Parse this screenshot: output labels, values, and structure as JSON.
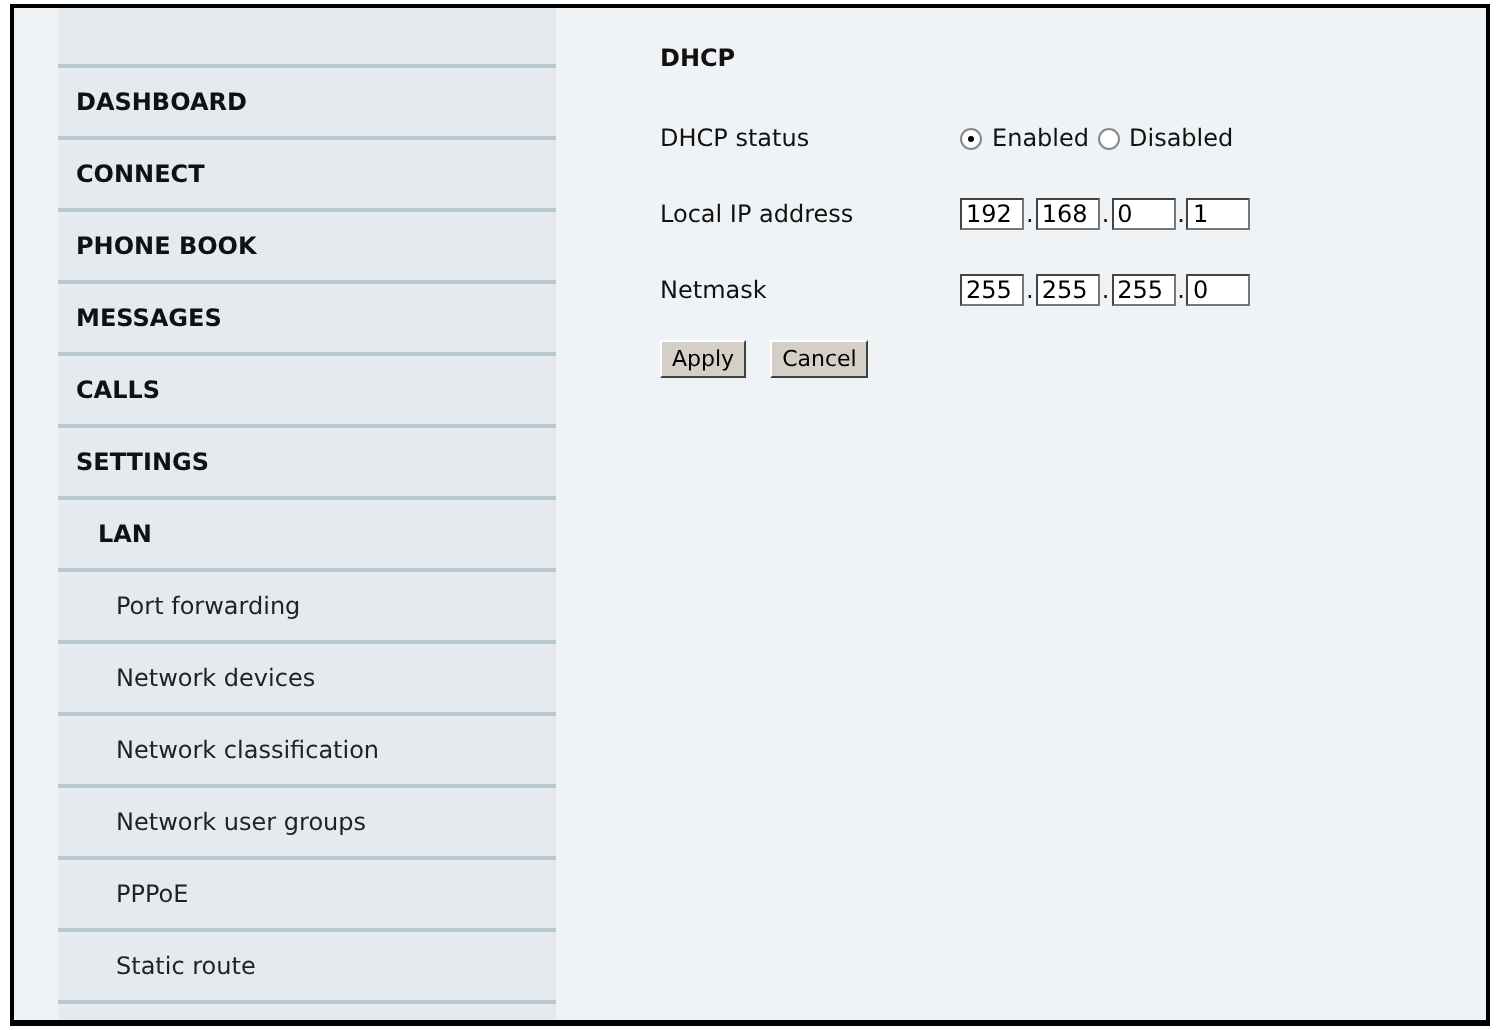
{
  "sidebar": {
    "items": [
      {
        "label": "DASHBOARD"
      },
      {
        "label": "CONNECT"
      },
      {
        "label": "PHONE BOOK"
      },
      {
        "label": "MESSAGES"
      },
      {
        "label": "CALLS"
      },
      {
        "label": "SETTINGS",
        "children": [
          {
            "label": "LAN",
            "children": [
              {
                "label": "Port forwarding"
              },
              {
                "label": "Network devices"
              },
              {
                "label": "Network classification"
              },
              {
                "label": "Network user groups"
              },
              {
                "label": "PPPoE"
              },
              {
                "label": "Static route"
              }
            ]
          }
        ]
      }
    ]
  },
  "main": {
    "heading": "DHCP",
    "rows": [
      {
        "kind": "radio",
        "label": "DHCP status",
        "options": [
          {
            "label": "Enabled",
            "selected": true
          },
          {
            "label": "Disabled",
            "selected": false
          }
        ]
      },
      {
        "kind": "ip",
        "label": "Local IP address",
        "octets": [
          "192",
          "168",
          "0",
          "1"
        ],
        "separator": "."
      },
      {
        "kind": "ip",
        "label": "Netmask",
        "octets": [
          "255",
          "255",
          "255",
          "0"
        ],
        "separator": "."
      }
    ],
    "buttons": [
      "Apply",
      "Cancel"
    ]
  }
}
